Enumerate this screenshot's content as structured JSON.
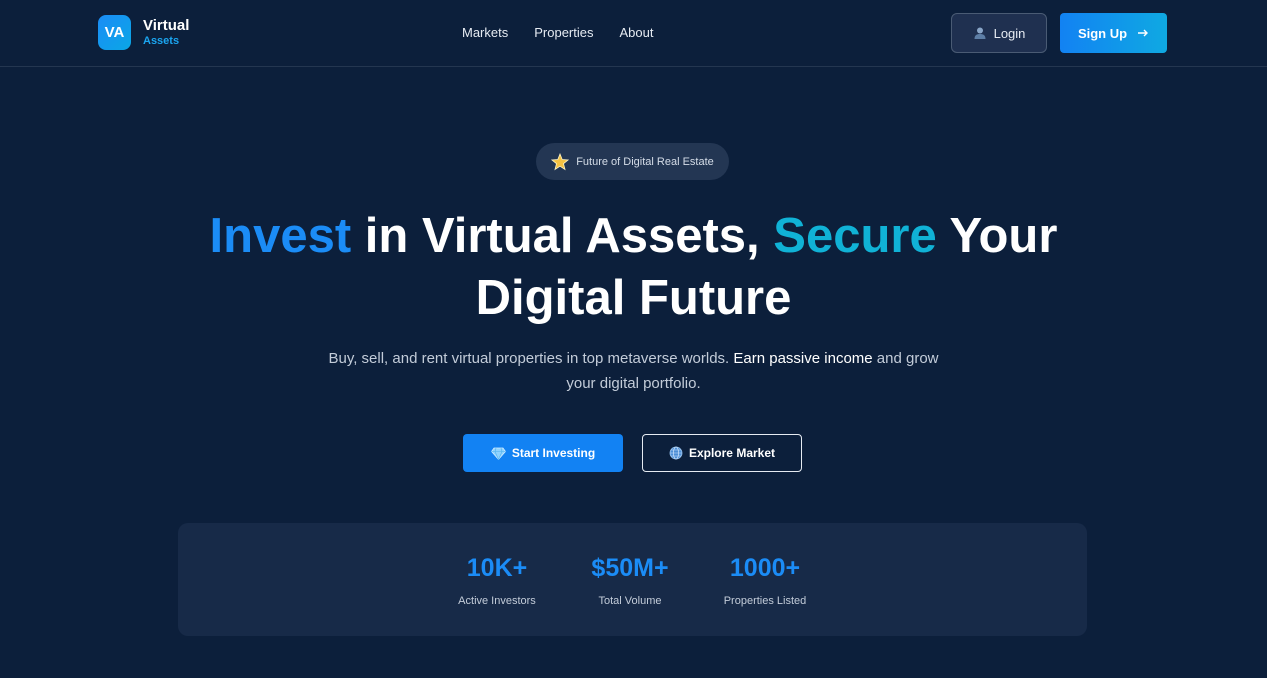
{
  "brand": {
    "badge": "VA",
    "title": "Virtual",
    "subtitle": "Assets"
  },
  "nav": {
    "links": [
      "Markets",
      "Properties",
      "About"
    ],
    "login_label": "Login",
    "signup_label": "Sign Up"
  },
  "hero": {
    "pill_text": "Future of Digital Real Estate",
    "headline_part1": "Invest",
    "headline_part2": " in Virtual Assets, ",
    "headline_part3": "Secure",
    "headline_part4": " Your",
    "headline_line2": "Digital Future",
    "subtext_part1": "Buy, sell, and rent virtual properties in top metaverse worlds. ",
    "subtext_strong": "Earn passive income",
    "subtext_part2": " and grow your digital portfolio.",
    "primary_cta": "Start Investing",
    "secondary_cta": "Explore Market"
  },
  "stats": [
    {
      "value": "10K+",
      "label": "Active Investors"
    },
    {
      "value": "$50M+",
      "label": "Total Volume"
    },
    {
      "value": "1000+",
      "label": "Properties Listed"
    }
  ],
  "colors": {
    "background": "#0c1f3b",
    "accent_blue": "#1b8cf6",
    "accent_cyan": "#10b2d6"
  },
  "icons": {
    "login": "user-icon",
    "signup": "arrow-right-icon",
    "pill": "star-icon",
    "primary_cta": "diamond-icon",
    "secondary_cta": "globe-icon"
  }
}
